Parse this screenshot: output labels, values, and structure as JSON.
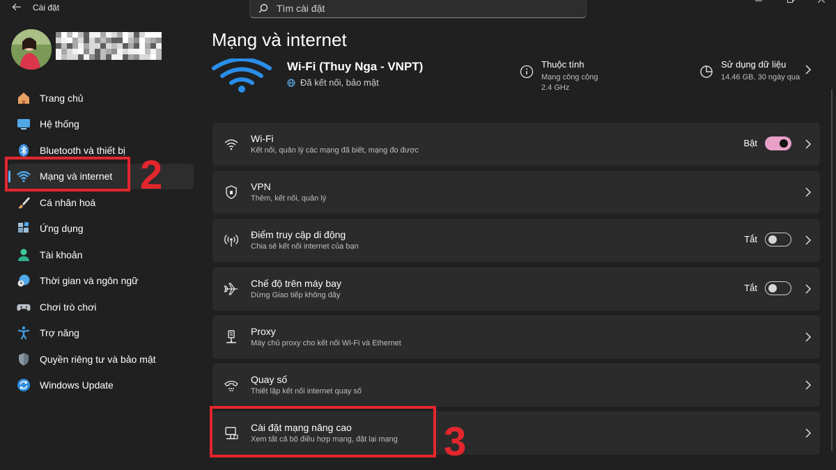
{
  "window": {
    "title": "Cài đặt"
  },
  "search": {
    "placeholder": "Tìm cài đặt"
  },
  "sidebar": {
    "items": [
      {
        "label": "Trang chủ",
        "icon": "home-icon"
      },
      {
        "label": "Hệ thống",
        "icon": "monitor-icon"
      },
      {
        "label": "Bluetooth và thiết bị",
        "icon": "bluetooth-icon"
      },
      {
        "label": "Mạng và internet",
        "icon": "wifi-icon",
        "active": true
      },
      {
        "label": "Cá nhân hoá",
        "icon": "brush-icon"
      },
      {
        "label": "Ứng dụng",
        "icon": "apps-icon"
      },
      {
        "label": "Tài khoản",
        "icon": "person-icon"
      },
      {
        "label": "Thời gian và ngôn ngữ",
        "icon": "clock-globe-icon"
      },
      {
        "label": "Chơi trò chơi",
        "icon": "gamepad-icon"
      },
      {
        "label": "Trợ năng",
        "icon": "accessibility-icon"
      },
      {
        "label": "Quyền riêng tư và bảo mật",
        "icon": "shield-icon"
      },
      {
        "label": "Windows Update",
        "icon": "update-icon"
      }
    ]
  },
  "annotations": {
    "step2": "2",
    "step3": "3",
    "color": "#e3262d"
  },
  "main": {
    "title": "Mạng và internet",
    "connection": {
      "name": "Wi-Fi (Thuy Nga - VNPT)",
      "status": "Đã kết nối, bảo mật"
    },
    "properties": {
      "title": "Thuộc tính",
      "line1": "Mạng công cộng",
      "line2": "2.4 GHz"
    },
    "data_usage": {
      "title": "Sử dụng dữ liệu",
      "detail": "14.46 GB, 30 ngày qua"
    },
    "cards": [
      {
        "title": "Wi-Fi",
        "subtitle": "Kết nối, quản lý các mạng đã biết, mạng đo được",
        "state": "Bật",
        "toggle": "on",
        "icon": "wifi-icon"
      },
      {
        "title": "VPN",
        "subtitle": "Thêm, kết nối, quản lý",
        "icon": "vpn-shield-icon"
      },
      {
        "title": "Điểm truy cập di động",
        "subtitle": "Chia sẻ kết nối internet của bạn",
        "state": "Tắt",
        "toggle": "off",
        "icon": "hotspot-icon"
      },
      {
        "title": "Chế độ trên máy bay",
        "subtitle": "Dừng Giao tiếp không dây",
        "state": "Tắt",
        "toggle": "off",
        "icon": "airplane-icon"
      },
      {
        "title": "Proxy",
        "subtitle": "Máy chủ proxy cho kết nối Wi-Fi và Ethernet",
        "icon": "proxy-icon"
      },
      {
        "title": "Quay số",
        "subtitle": "Thiết lập kết nối internet quay số",
        "icon": "dialup-icon"
      },
      {
        "title": "Cài đặt mạng nâng cao",
        "subtitle": "Xem tất cả bộ điều hợp mạng, đặt lại mạng",
        "icon": "network-pc-icon"
      }
    ]
  },
  "colors": {
    "accent": "#5fb2f2",
    "toggle_on": "#e8a0c6",
    "background": "#202020",
    "card": "#2b2b2b"
  }
}
